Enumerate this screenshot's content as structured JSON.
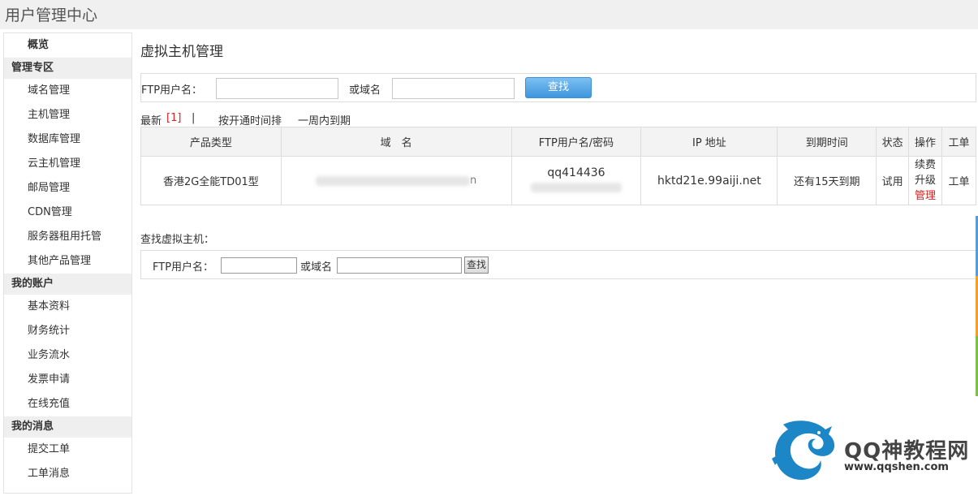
{
  "app": {
    "title": "用户管理中心"
  },
  "sidebar": {
    "overview": "概览",
    "groups": [
      {
        "title": "管理专区",
        "items": [
          "域名管理",
          "主机管理",
          "数据库管理",
          "云主机管理",
          "邮局管理",
          "CDN管理",
          "服务器租用托管",
          "其他产品管理"
        ]
      },
      {
        "title": "我的账户",
        "items": [
          "基本资料",
          "财务统计",
          "业务流水",
          "发票申请",
          "在线充值"
        ]
      },
      {
        "title": "我的消息",
        "items": [
          "提交工单",
          "工单消息"
        ]
      }
    ]
  },
  "main": {
    "title": "虚拟主机管理",
    "search": {
      "ftp_label": "FTP用户名：",
      "ftp_value": "",
      "domain_label": "或域名",
      "domain_value": "",
      "button": "查找"
    },
    "filters": {
      "latest": "最新",
      "latest_count": "[1]",
      "separator": "|",
      "sort_open_time": "按开通时间排",
      "expire_week": "一周内到期"
    },
    "table": {
      "headers": [
        "产品类型",
        "域　名",
        "FTP用户名/密码",
        "IP 地址",
        "到期时间",
        "状态",
        "操作",
        "工单"
      ],
      "rows": [
        {
          "product": "香港2G全能TD01型",
          "domain_suffix": "n",
          "ftp_user": "qq414436",
          "ip": "hktd21e.99aiji.net",
          "expire": "还有15天到期",
          "status": "试用",
          "action_renew": "续费",
          "action_upgrade": "升级",
          "action_manage": "管理",
          "ticket": "工单"
        }
      ]
    },
    "find_section": {
      "title": "查找虚拟主机：",
      "ftp_label": "FTP用户名：",
      "domain_label": "或域名",
      "button": "查找"
    }
  },
  "watermark": {
    "brand": "QQ神教程网",
    "url": "www.qqshen.com"
  },
  "colors": {
    "accent_red": "#dd2222",
    "button_blue": "#3e95dd"
  }
}
